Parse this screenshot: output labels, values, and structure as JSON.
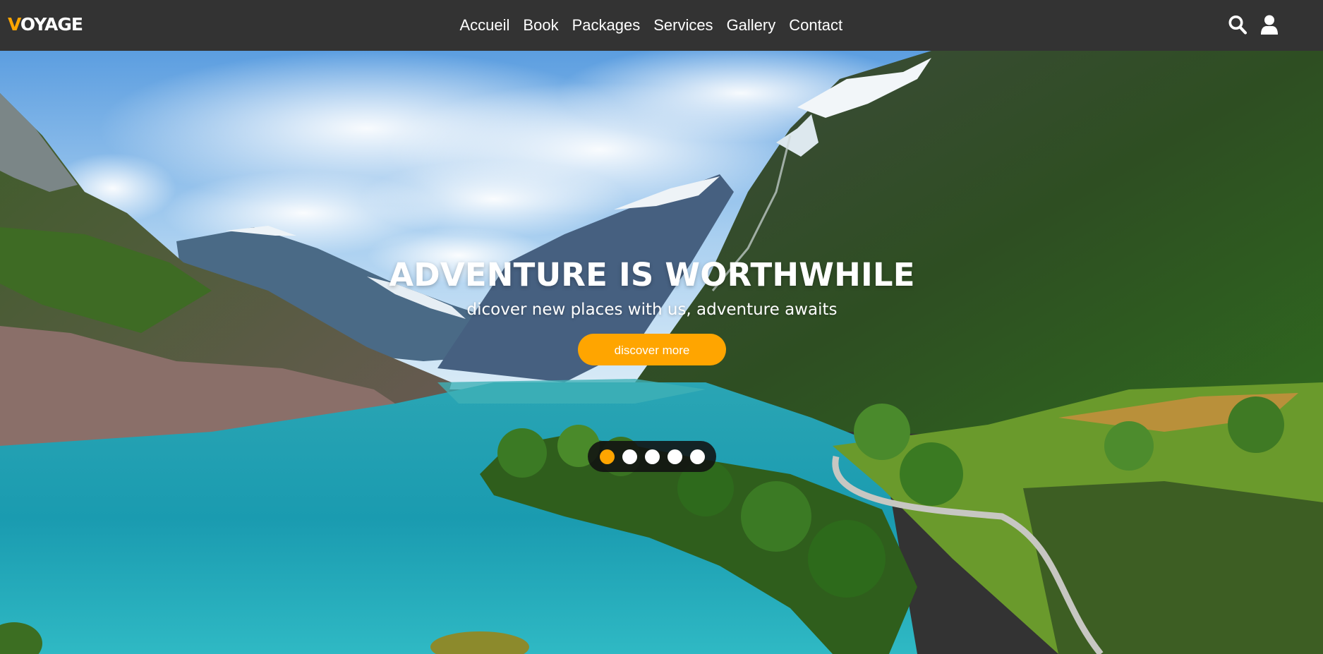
{
  "header": {
    "logo_first_letter": "V",
    "logo_rest": "OYAGE",
    "nav": [
      "Accueil",
      "Book",
      "Packages",
      "Services",
      "Gallery",
      "Contact"
    ],
    "icons": [
      "search-icon",
      "user-icon"
    ]
  },
  "hero": {
    "title": "ADVENTURE IS WORTHWHILE",
    "subtitle": "dicover new places with us, adventure awaits",
    "button_label": "discover more",
    "slides_total": 5,
    "active_slide": 1
  },
  "colors": {
    "accent": "#ffa500",
    "header_bg": "#333333",
    "text": "#ffffff"
  }
}
